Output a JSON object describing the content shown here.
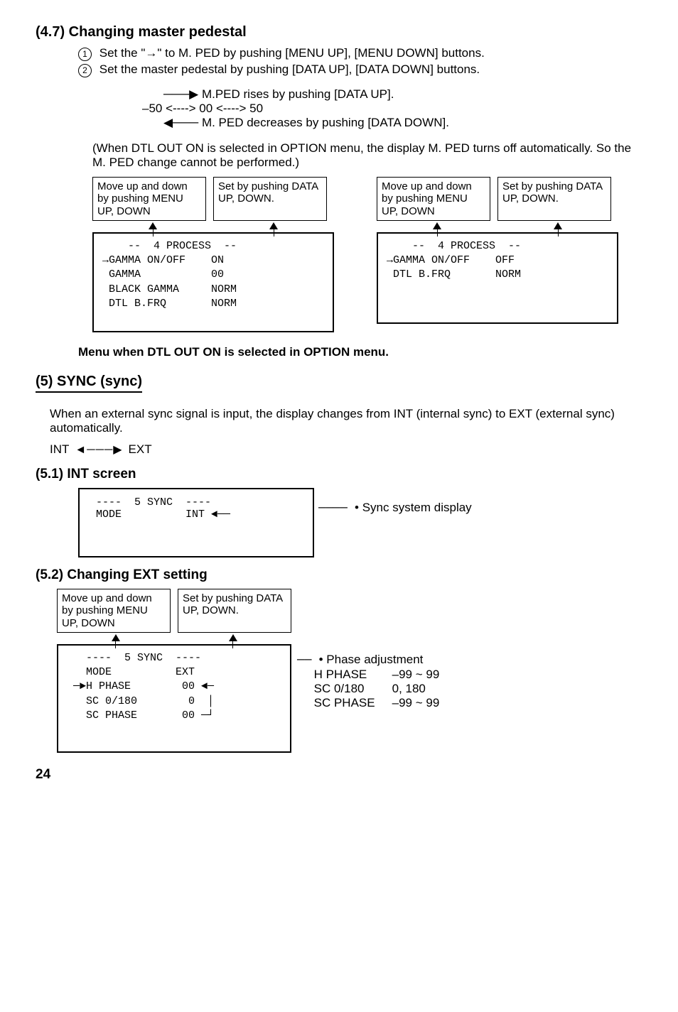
{
  "s47": {
    "heading": "(4.7) Changing master pedestal",
    "step1": "Set the \"→\" to M. PED by pushing [MENU UP], [MENU DOWN] buttons.",
    "step2": "Set the master pedestal by pushing [DATA UP], [DATA DOWN] buttons.",
    "rise": "M.PED rises by pushing [DATA UP].",
    "range": "–50  <---->  00  <---->  50",
    "dec": "M. PED decreases by pushing [DATA DOWN].",
    "note": "(When DTL OUT ON is selected in OPTION menu, the display M. PED turns off automatically. So the M. PED change cannot be performed.)",
    "hintMove": "Move up and down by pushing MENU UP, DOWN",
    "hintSet": "Set by pushing DATA UP, DOWN.",
    "menuLeft": "    --  4 PROCESS  --\n→GAMMA ON/OFF    ON\n GAMMA           00\n BLACK GAMMA     NORM\n DTL B.FRQ       NORM",
    "menuRight": "    --  4 PROCESS  --\n→GAMMA ON/OFF    OFF\n DTL B.FRQ       NORM",
    "caption": "Menu when DTL OUT ON is selected in OPTION menu."
  },
  "s5": {
    "heading": "(5) SYNC (sync)",
    "intro": "When an external sync signal is input, the display changes from INT (internal sync) to EXT (external sync) automatically.",
    "intLabel": "INT",
    "extLabel": "EXT"
  },
  "s51": {
    "heading": "(5.1) INT screen",
    "menu": " ----  5 SYNC  ----\n MODE          INT ◄──",
    "side": "• Sync system display"
  },
  "s52": {
    "heading": "(5.2) Changing EXT setting",
    "hintMove": "Move up and down by pushing MENU UP, DOWN",
    "hintSet": "Set by pushing DATA UP, DOWN.",
    "menu": "   ----  5 SYNC  ----\n   MODE          EXT\n ─►H PHASE        00 ◄─\n   SC 0/180        0  │\n   SC PHASE       00 ─┘",
    "phaseTitle": "• Phase adjustment",
    "phase": [
      {
        "k": "H PHASE",
        "v": "–99 ~ 99"
      },
      {
        "k": "SC 0/180",
        "v": "0, 180"
      },
      {
        "k": "SC PHASE",
        "v": "–99 ~ 99"
      }
    ]
  },
  "pageNumber": "24"
}
